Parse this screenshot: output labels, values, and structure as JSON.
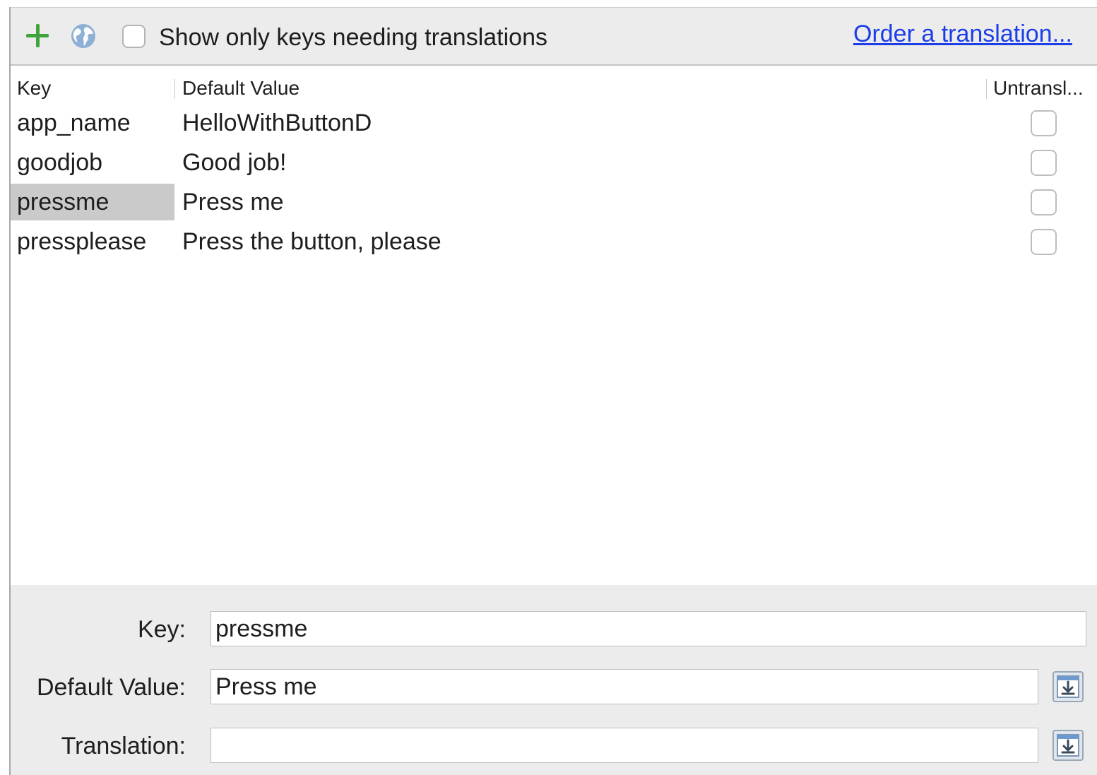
{
  "toolbar": {
    "show_only_label": "Show only keys needing translations",
    "order_link": "Order a translation..."
  },
  "table": {
    "headers": {
      "key": "Key",
      "default_value": "Default Value",
      "untranslatable": "Untransl..."
    },
    "rows": [
      {
        "key": "app_name",
        "value": "HelloWithButtonD",
        "untranslatable": false,
        "selected": false
      },
      {
        "key": "goodjob",
        "value": "Good job!",
        "untranslatable": false,
        "selected": false
      },
      {
        "key": "pressme",
        "value": "Press me",
        "untranslatable": false,
        "selected": true
      },
      {
        "key": "pressplease",
        "value": "Press the button, please",
        "untranslatable": false,
        "selected": false
      }
    ]
  },
  "editor": {
    "key_label": "Key:",
    "key_value": "pressme",
    "default_label": "Default Value:",
    "default_value": "Press me",
    "translation_label": "Translation:",
    "translation_value": ""
  },
  "colors": {
    "add_icon": "#3fa33a",
    "link": "#1b3ee8",
    "selection": "#cacaca",
    "panel_bg": "#ececec"
  }
}
